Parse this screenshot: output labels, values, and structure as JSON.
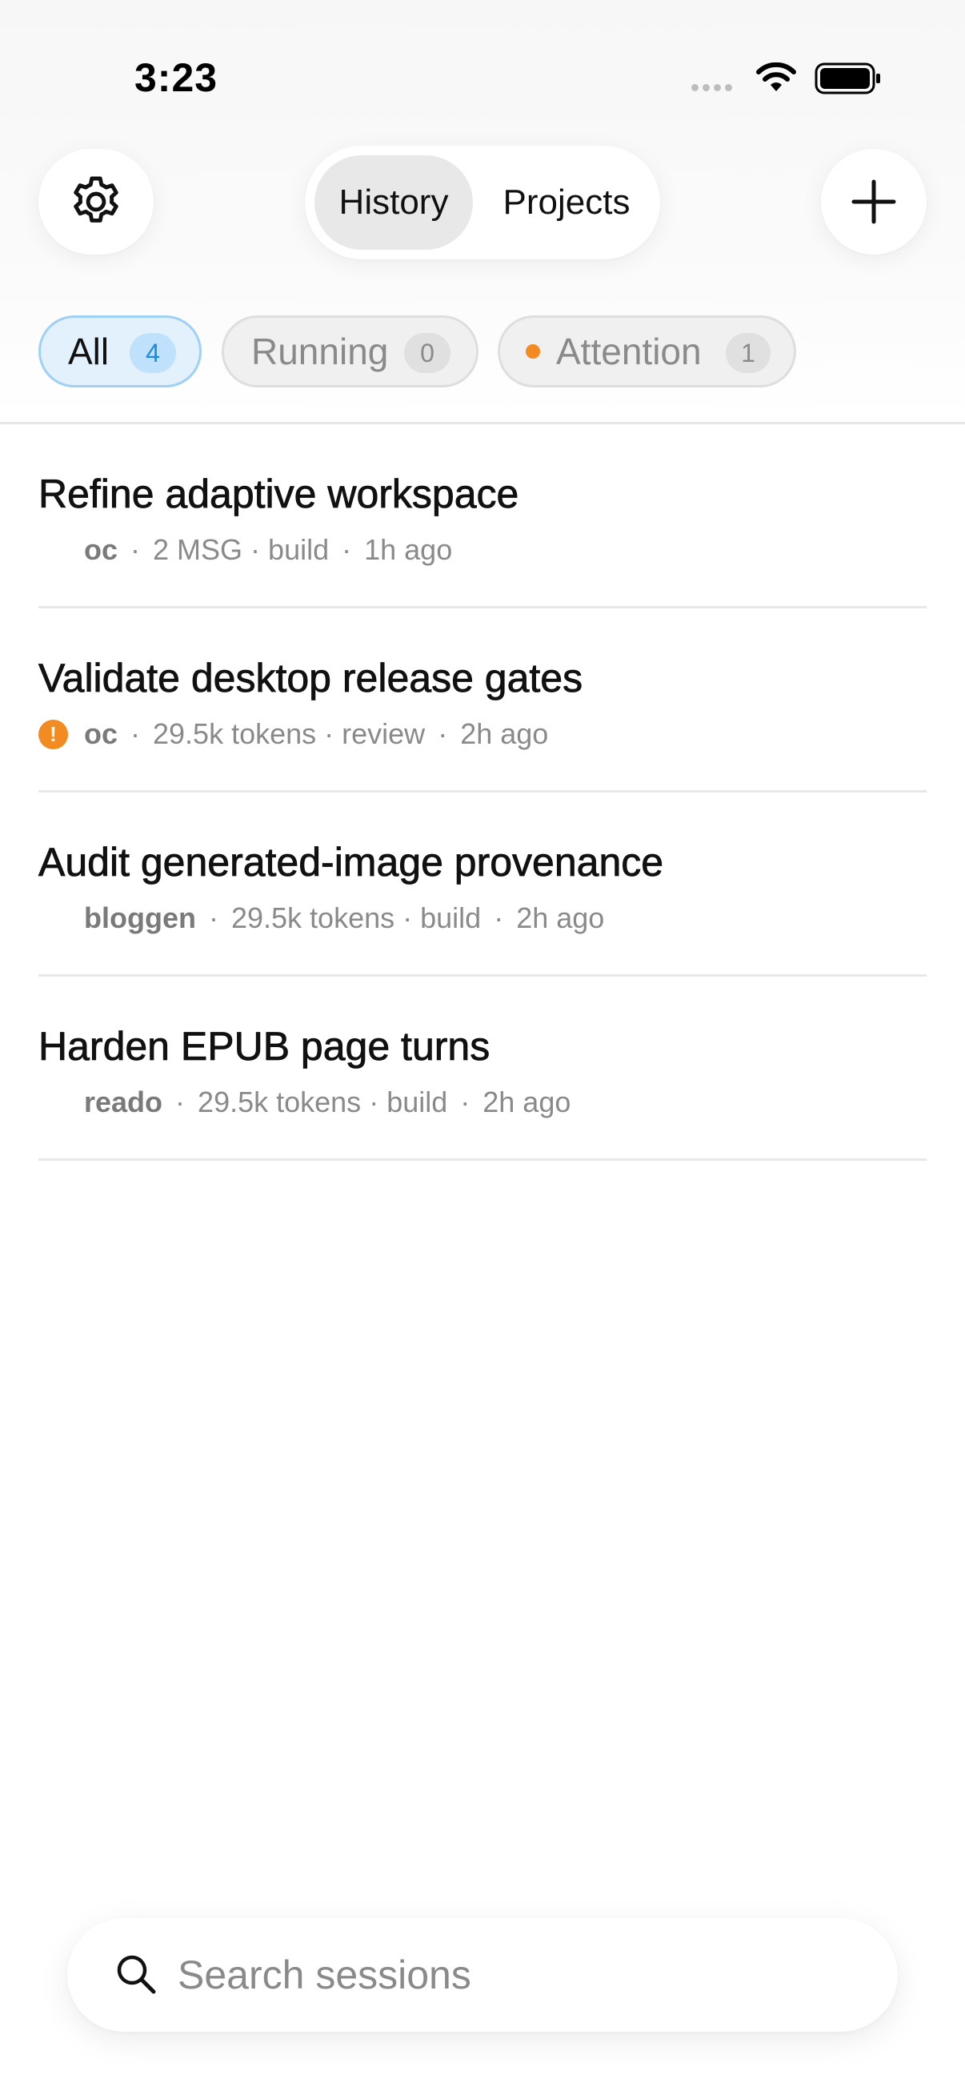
{
  "status_bar": {
    "time": "3:23"
  },
  "header": {
    "settings_icon": "gear-icon",
    "add_icon": "plus-icon",
    "tabs": [
      {
        "label": "History",
        "selected": true
      },
      {
        "label": "Projects",
        "selected": false
      }
    ]
  },
  "filters": [
    {
      "label": "All",
      "count": "4",
      "active": true
    },
    {
      "label": "Running",
      "count": "0",
      "active": false
    },
    {
      "label": "Attention",
      "count": "1",
      "active": false,
      "dot_color": "#f28b22"
    }
  ],
  "sessions": [
    {
      "title": "Refine adaptive workspace",
      "project": "oc",
      "stat": "2 MSG",
      "mode": "build",
      "age": "1h ago",
      "warning": false
    },
    {
      "title": "Validate desktop release gates",
      "project": "oc",
      "stat": "29.5k tokens",
      "mode": "review",
      "age": "2h ago",
      "warning": true
    },
    {
      "title": "Audit generated-image provenance",
      "project": "bloggen",
      "stat": "29.5k tokens",
      "mode": "build",
      "age": "2h ago",
      "warning": false
    },
    {
      "title": "Harden EPUB page turns",
      "project": "reado",
      "stat": "29.5k tokens",
      "mode": "build",
      "age": "2h ago",
      "warning": false
    }
  ],
  "separators": {
    "dot": "·"
  },
  "warning_glyph": "!",
  "search": {
    "placeholder": "Search sessions",
    "value": ""
  },
  "colors": {
    "accent": "#1b8ae6",
    "attention": "#f28b22"
  }
}
